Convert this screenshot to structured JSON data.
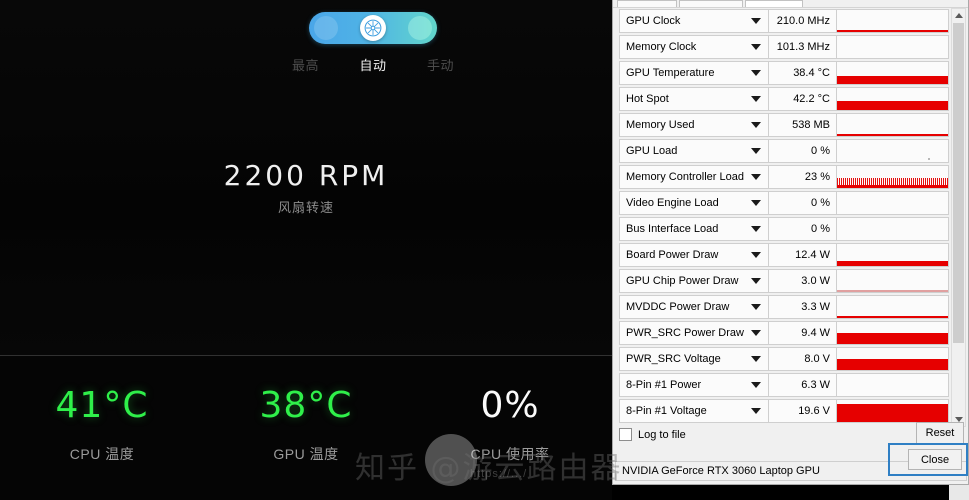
{
  "fan_panel": {
    "toggle": {
      "icon": "fan-snowflake-icon",
      "active_mode_index": 1,
      "gradient_start": "#4aa6e8",
      "gradient_end": "#62d6cb"
    },
    "modes": [
      {
        "label": "最高",
        "active": false
      },
      {
        "label": "自动",
        "active": true
      },
      {
        "label": "手动",
        "active": false
      }
    ],
    "rpm": {
      "value": "2200 RPM",
      "caption": "风扇转速"
    },
    "stats": [
      {
        "value": "41°C",
        "label": "CPU 温度",
        "color": "#2ff04a",
        "style": "green"
      },
      {
        "value": "38°C",
        "label": "GPU 温度",
        "color": "#2ff04a",
        "style": "green"
      },
      {
        "value": "0%",
        "label": "CPU 使用率",
        "color": "#fbfbfb",
        "style": "white"
      }
    ]
  },
  "gpuz": {
    "sensors": [
      {
        "name": "GPU Clock",
        "value": "210.0 MHz",
        "graph": "line-low",
        "fill": 2
      },
      {
        "name": "Memory Clock",
        "value": "101.3 MHz",
        "graph": "none",
        "fill": 0
      },
      {
        "name": "GPU Temperature",
        "value": "38.4 °C",
        "graph": "thick",
        "fill": 8
      },
      {
        "name": "Hot Spot",
        "value": "42.2 °C",
        "graph": "thick",
        "fill": 9
      },
      {
        "name": "Memory Used",
        "value": "538 MB",
        "graph": "line-low",
        "fill": 2
      },
      {
        "name": "GPU Load",
        "value": "0 %",
        "graph": "dot",
        "fill": 0
      },
      {
        "name": "Memory Controller Load",
        "value": "23 %",
        "graph": "noise",
        "fill": 4
      },
      {
        "name": "Video Engine Load",
        "value": "0 %",
        "graph": "none",
        "fill": 0
      },
      {
        "name": "Bus Interface Load",
        "value": "0 %",
        "graph": "none",
        "fill": 0
      },
      {
        "name": "Board Power Draw",
        "value": "12.4 W",
        "graph": "thick",
        "fill": 5
      },
      {
        "name": "GPU Chip Power Draw",
        "value": "3.0 W",
        "graph": "faint",
        "fill": 2
      },
      {
        "name": "MVDDC Power Draw",
        "value": "3.3 W",
        "graph": "line-low",
        "fill": 2
      },
      {
        "name": "PWR_SRC Power Draw",
        "value": "9.4 W",
        "graph": "thick",
        "fill": 11
      },
      {
        "name": "PWR_SRC Voltage",
        "value": "8.0 V",
        "graph": "thick",
        "fill": 11
      },
      {
        "name": "8-Pin #1 Power",
        "value": "6.3 W",
        "graph": "none",
        "fill": 0
      },
      {
        "name": "8-Pin #1 Voltage",
        "value": "19.6 V",
        "graph": "thick",
        "fill": 18
      }
    ],
    "log_to_file_label": "Log to file",
    "log_to_file_checked": false,
    "reset_label": "Reset",
    "close_label": "Close",
    "status_text": "NVIDIA GeForce RTX 3060 Laptop GPU",
    "graph_color": "#e60000"
  },
  "watermark": {
    "main": "知乎 @游云路由器",
    "sub": "https://.../"
  }
}
